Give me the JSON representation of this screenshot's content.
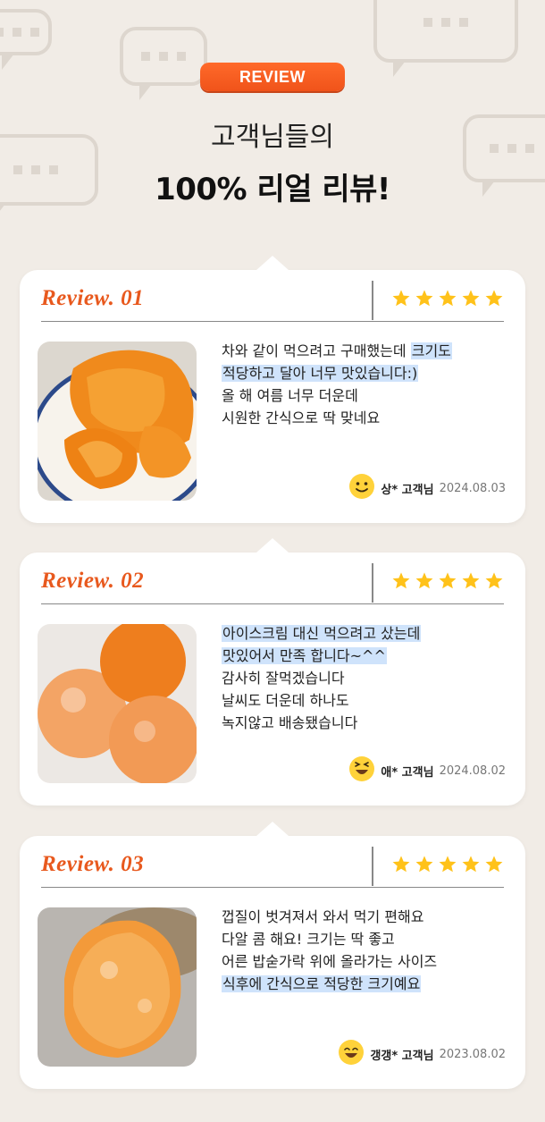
{
  "header": {
    "pill": "REVIEW",
    "title_line1": "고객님들의",
    "title_line2": "100% 리얼 리뷰!"
  },
  "colors": {
    "accent": "#f0531a",
    "star": "#ffc21a",
    "highlight": "#cfe3fb",
    "background": "#f1ece6"
  },
  "reviews": [
    {
      "label": "Review. 01",
      "rating": 5,
      "photo_icon": "persimmon-photo",
      "lines": [
        [
          {
            "t": "차와 같이 먹으려고 구매했는데 "
          },
          {
            "t": "크기도",
            "hl": true
          }
        ],
        [
          {
            "t": "적당하고 달아 너무 맛있습니다:)",
            "hl": true
          }
        ],
        [
          {
            "t": "올 해 여름 너무 더운데"
          }
        ],
        [
          {
            "t": "시원한 간식으로 딱 맞네요"
          }
        ]
      ],
      "author": "상* 고객님",
      "date": "2024.08.03"
    },
    {
      "label": "Review. 02",
      "rating": 5,
      "photo_icon": "persimmon-photo",
      "lines": [
        [
          {
            "t": "아이스크림 대신 먹으려고 샀는데",
            "hl": true
          }
        ],
        [
          {
            "t": "맛있어서 만족 합니다~^^",
            "hl": true
          }
        ],
        [
          {
            "t": "감사히 잘먹겠습니다"
          }
        ],
        [
          {
            "t": "날씨도 더운데 하나도"
          }
        ],
        [
          {
            "t": "녹지않고 배송됐습니다"
          }
        ]
      ],
      "author": "애* 고객님",
      "date": "2024.08.02"
    },
    {
      "label": "Review. 03",
      "rating": 5,
      "photo_icon": "persimmon-photo",
      "lines": [
        [
          {
            "t": "껍질이 벗겨져서 와서 먹기 편해요"
          }
        ],
        [
          {
            "t": "다알 콤 해요! 크기는 딱 좋고"
          }
        ],
        [
          {
            "t": "어른 밥숟가락 위에 올라가는 사이즈"
          }
        ],
        [
          {
            "t": "식후에 간식으로 적당한 크기예요",
            "hl": true
          }
        ]
      ],
      "author": "갱갱* 고객님",
      "date": "2023.08.02"
    }
  ]
}
